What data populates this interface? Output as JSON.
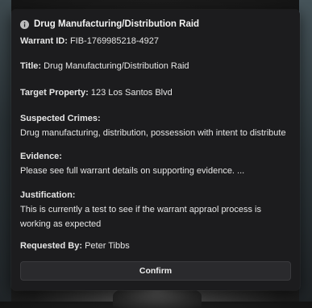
{
  "modal": {
    "title": "Drug Manufacturing/Distribution Raid",
    "icon": "info-icon",
    "warrant_id": {
      "label": "Warrant ID:",
      "value": "FIB-1769985218-4927"
    },
    "title_field": {
      "label": "Title:",
      "value": "Drug Manufacturing/Distribution Raid"
    },
    "target_property": {
      "label": "Target Property:",
      "value": "123 Los Santos Blvd"
    },
    "suspected_crimes": {
      "label": "Suspected Crimes:",
      "value": "Drug manufacturing, distribution, possession with intent to distribute"
    },
    "evidence": {
      "label": "Evidence:",
      "value": "Please see full warrant details on supporting evidence. ..."
    },
    "justification": {
      "label": "Justification:",
      "value": "This is currently a test to see if the warrant appraol process is working as expected"
    },
    "requested_by": {
      "label": "Requested By:",
      "value": "Peter Tibbs"
    },
    "confirm_label": "Confirm"
  },
  "colors": {
    "modal_bg": "#1c1c1e",
    "text": "#e6e6e6",
    "button_bg": "#2a2a2d"
  }
}
